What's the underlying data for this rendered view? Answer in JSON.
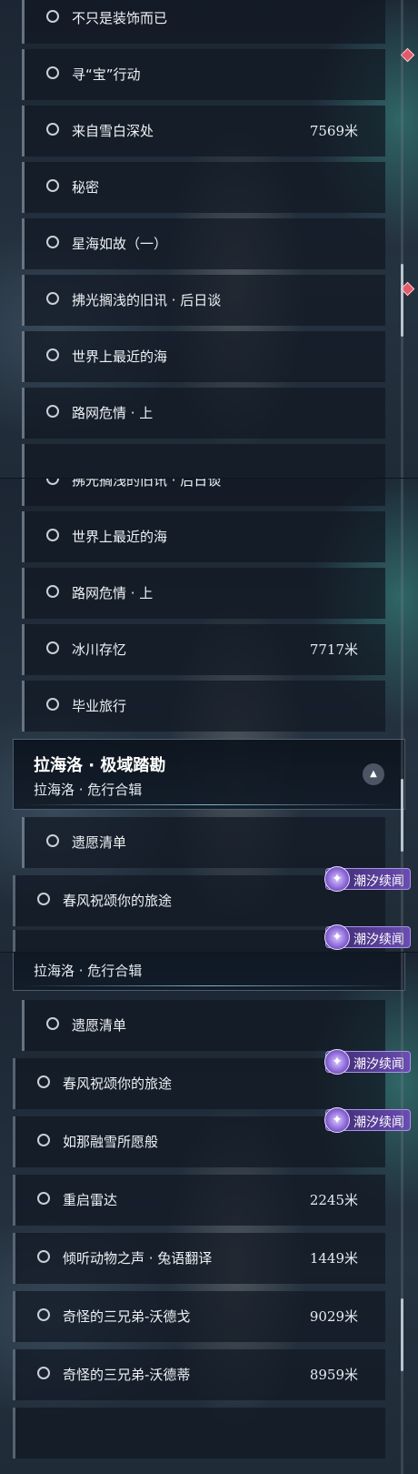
{
  "panel1": {
    "rows": [
      {
        "label": "不只是装饰而已",
        "distance": ""
      },
      {
        "label": "寻“宝”行动",
        "distance": ""
      },
      {
        "label": "来自雪白深处",
        "distance": "7569米"
      },
      {
        "label": "秘密",
        "distance": ""
      },
      {
        "label": "星海如故（一）",
        "distance": ""
      },
      {
        "label": "拂光搁浅的旧讯 · 后日谈",
        "distance": ""
      },
      {
        "label": "世界上最近的海",
        "distance": ""
      },
      {
        "label": "路网危情 · 上",
        "distance": ""
      }
    ]
  },
  "panel2": {
    "partial_label": "拂光搁浅的旧讯 · 后日谈",
    "rows": [
      {
        "label": "世界上最近的海",
        "distance": ""
      },
      {
        "label": "路网危情 · 上",
        "distance": ""
      },
      {
        "label": "冰川存忆",
        "distance": "7717米"
      },
      {
        "label": "毕业旅行",
        "distance": ""
      }
    ],
    "header": {
      "title": "拉海洛 · 极域踏勘",
      "subtitle": "拉海洛 · 危行合辑"
    },
    "after_rows": [
      {
        "label": "遗愿清单",
        "distance": ""
      },
      {
        "label": "春风祝颂你的旅途",
        "distance": ""
      }
    ],
    "badge_text": "潮汐续闻",
    "partial_badge_text": "潮汐续闻"
  },
  "panel3": {
    "header_subtitle": "拉海洛 · 危行合辑",
    "rows": [
      {
        "label": "遗愿清单",
        "distance": ""
      },
      {
        "label": "春风祝颂你的旅途",
        "distance": ""
      },
      {
        "label": "如那融雪所愿般",
        "distance": ""
      },
      {
        "label": "重启雷达",
        "distance": "2245米"
      },
      {
        "label": "倾听动物之声 · 兔语翻译",
        "distance": "1449米"
      },
      {
        "label": "奇怪的三兄弟-沃德戈",
        "distance": "9029米"
      },
      {
        "label": "奇怪的三兄弟-沃德蒂",
        "distance": "8959米"
      }
    ],
    "badge_text": "潮汐续闻"
  },
  "colors": {
    "accent_badge": "#6a4cb3",
    "marker": "#e35a6a"
  },
  "icons": {
    "row": "circle-outline-icon",
    "badge": "tide-story-icon",
    "marker": "red-diamond-icon",
    "collapse": "chevron-up-icon"
  }
}
